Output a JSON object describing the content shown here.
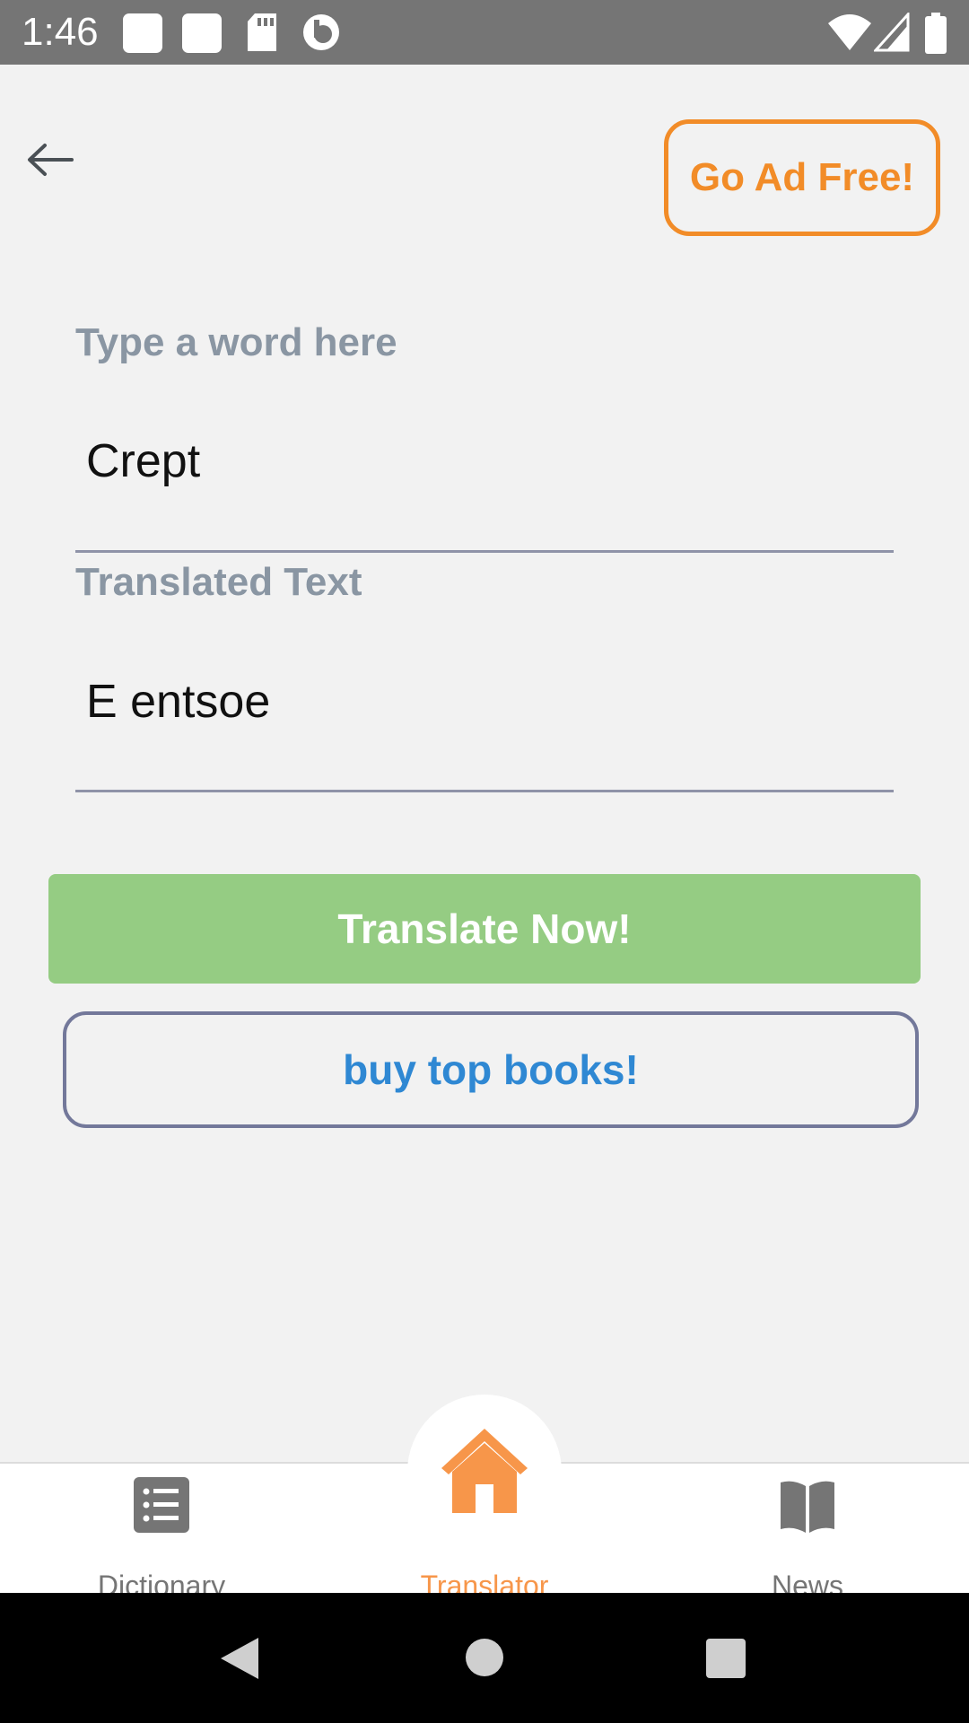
{
  "status_bar": {
    "time": "1:46"
  },
  "header": {
    "ad_free_label": "Go Ad Free!"
  },
  "input_field": {
    "label": "Type a word here",
    "value": "Crept"
  },
  "output_field": {
    "label": "Translated Text",
    "value": "E entsoe"
  },
  "actions": {
    "translate_label": "Translate Now!",
    "books_label": "buy top books!"
  },
  "bottom_nav": {
    "items": [
      {
        "label": "Dictionary",
        "icon": "list-icon"
      },
      {
        "label": "Translator",
        "icon": "home-icon"
      },
      {
        "label": "News",
        "icon": "book-icon"
      }
    ],
    "active_index": 1
  },
  "colors": {
    "accent_orange": "#f28c28",
    "button_green": "#95cc83",
    "link_blue": "#2f88d3",
    "label_gray": "#8a96a3",
    "inactive_gray": "#757575"
  }
}
